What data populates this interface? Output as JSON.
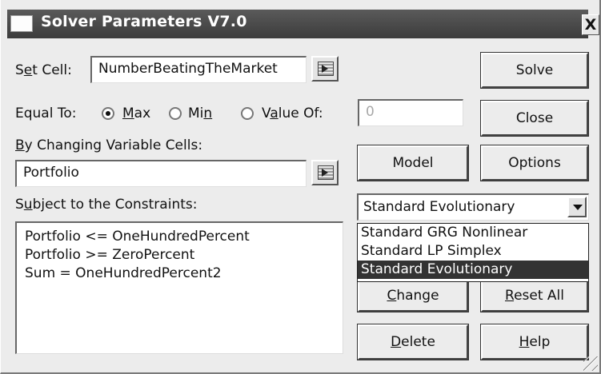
{
  "window": {
    "title": "Solver Parameters V7.0",
    "close_label": "X"
  },
  "set_cell": {
    "label_pre": "S",
    "label_underlined": "e",
    "label_post": "t Cell:",
    "value": "NumberBeatingTheMarket"
  },
  "equal_to": {
    "label": "Equal To:",
    "options": [
      {
        "pre": "",
        "ul": "M",
        "post": "ax",
        "selected": true
      },
      {
        "pre": "Mi",
        "ul": "n",
        "post": "",
        "selected": false
      },
      {
        "pre": "V",
        "ul": "a",
        "post": "lue Of:",
        "selected": false
      }
    ],
    "value_of": "0"
  },
  "changing": {
    "label_ul": "B",
    "label_post": "y Changing Variable Cells:",
    "value": "Portfolio"
  },
  "constraints": {
    "label_pre": "S",
    "label_ul": "u",
    "label_post": "bject to the Constraints:",
    "items": [
      "Portfolio <= OneHundredPercent",
      "Portfolio >= ZeroPercent",
      "Sum = OneHundredPercent2"
    ]
  },
  "engine": {
    "selected": "Standard Evolutionary",
    "options": [
      "Standard GRG Nonlinear",
      "Standard LP Simplex",
      "Standard Evolutionary"
    ],
    "highlighted_index": 2
  },
  "buttons": {
    "solve": "Solve",
    "close": "Close",
    "model": "Model",
    "options": "Options",
    "change_ul": "C",
    "change_post": "hange",
    "reset_ul": "R",
    "reset_post": "eset All",
    "delete_ul": "D",
    "delete_post": "elete",
    "help_ul": "H",
    "help_post": "elp"
  }
}
